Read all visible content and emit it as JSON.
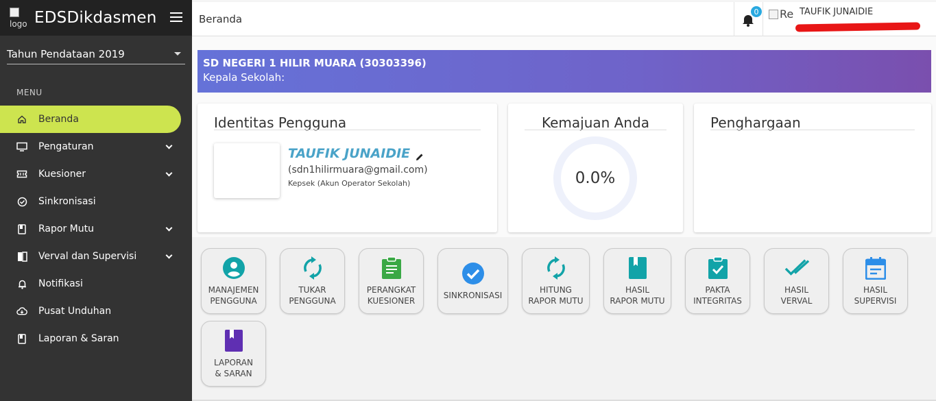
{
  "sidebar": {
    "logo_alt": "logo",
    "brand": "EDSDikdasmen",
    "year_select": "Tahun Pendataan 2019",
    "menu_heading": "MENU",
    "items": [
      {
        "label": "Beranda",
        "icon": "home-icon"
      },
      {
        "label": "Pengaturan",
        "icon": "monitor-icon"
      },
      {
        "label": "Kuesioner",
        "icon": "ticket-icon"
      },
      {
        "label": "Sinkronisasi",
        "icon": "check-circle-icon"
      },
      {
        "label": "Rapor Mutu",
        "icon": "book-icon"
      },
      {
        "label": "Verval dan Supervisi",
        "icon": "book-open-icon"
      },
      {
        "label": "Notifikasi",
        "icon": "bell-icon"
      },
      {
        "label": "Pusat Unduhan",
        "icon": "cloud-download-icon"
      },
      {
        "label": "Laporan & Saran",
        "icon": "book-icon"
      }
    ]
  },
  "topbar": {
    "breadcrumb": "Beranda",
    "notification_count": "0",
    "avatar_alt": "Re",
    "username": "TAUFIK JUNAIDIE"
  },
  "banner": {
    "school": "SD NEGERI 1 HILIR MUARA (30303396)",
    "role": "Kepala Sekolah:"
  },
  "identity": {
    "title": "Identitas Pengguna",
    "name": "TAUFIK JUNAIDIE",
    "email": "(sdn1hilirmuara@gmail.com)",
    "role": "Kepsek (Akun Operator Sekolah)"
  },
  "progress": {
    "title": "Kemajuan Anda",
    "value": "0.0%"
  },
  "award": {
    "title": "Penghargaan"
  },
  "tiles": [
    {
      "label": "MANAJEMEN\nPENGGUNA",
      "icon": "account-circle-icon",
      "color": "#12a3a8"
    },
    {
      "label": "TUKAR\nPENGGUNA",
      "icon": "sync-icon",
      "color": "#12a3a8"
    },
    {
      "label": "PERANGKAT\nKUESIONER",
      "icon": "clipboard-icon",
      "color": "#3aa845"
    },
    {
      "label": "SINKRONISASI",
      "icon": "check-circle-icon",
      "color": "#2d8ee8"
    },
    {
      "label": "HITUNG\nRAPOR MUTU",
      "icon": "sync-icon",
      "color": "#12a3a8"
    },
    {
      "label": "HASIL\nRAPOR MUTU",
      "icon": "book-icon",
      "color": "#12a3a8"
    },
    {
      "label": "PAKTA\nINTEGRITAS",
      "icon": "clipboard-check-icon",
      "color": "#12a3a8"
    },
    {
      "label": "HASIL\nVERVAL",
      "icon": "double-check-icon",
      "color": "#12a3a8"
    },
    {
      "label": "HASIL\nSUPERVISI",
      "icon": "calendar-icon",
      "color": "#2d8ee8"
    },
    {
      "label": "LAPORAN\n& SARAN",
      "icon": "book-icon",
      "color": "#5f2fb2"
    }
  ]
}
